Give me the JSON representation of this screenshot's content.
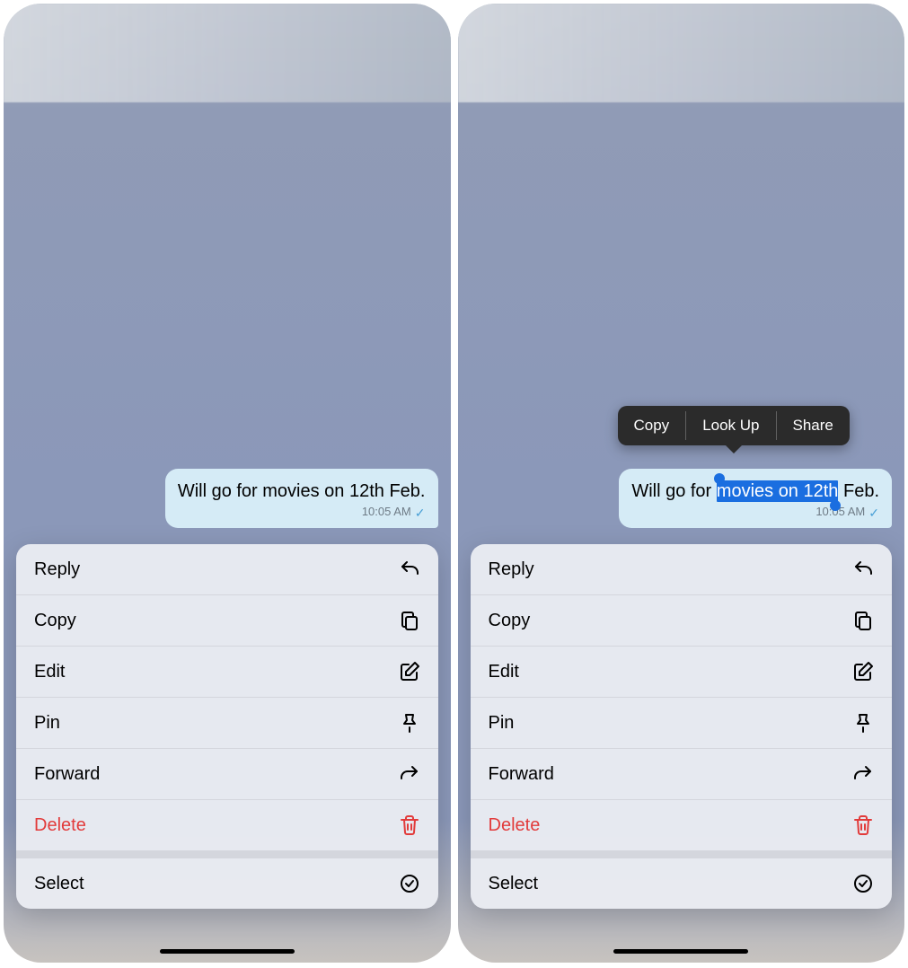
{
  "message": {
    "prefix": "Will go for ",
    "selected": "movies on 12th",
    "suffix": " Feb.",
    "full": "Will go for movies on 12th Feb.",
    "time": "10:05 AM"
  },
  "menu": {
    "reply": "Reply",
    "copy": "Copy",
    "edit": "Edit",
    "pin": "Pin",
    "forward": "Forward",
    "delete": "Delete",
    "select": "Select"
  },
  "popover": {
    "copy": "Copy",
    "lookup": "Look Up",
    "share": "Share"
  }
}
